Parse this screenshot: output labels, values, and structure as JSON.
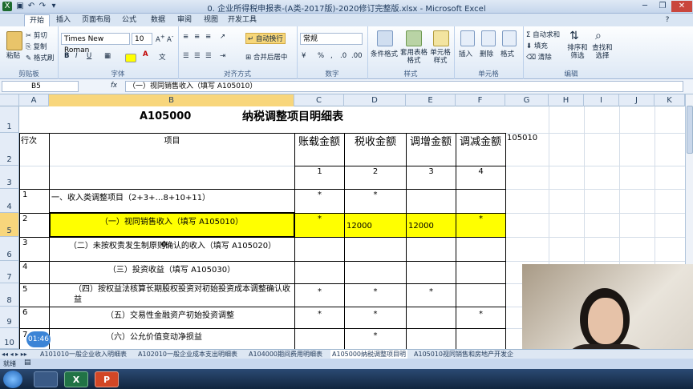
{
  "window": {
    "title": "0. 企业所得税申报表-(A类-2017版)-2020修订完整版.xlsx - Microsoft Excel"
  },
  "ribbon_tabs": [
    "开始",
    "插入",
    "页面布局",
    "公式",
    "数据",
    "审阅",
    "视图",
    "开发工具"
  ],
  "ribbon": {
    "clipboard": {
      "paste": "粘贴",
      "cut": "剪切",
      "copy": "复制",
      "format_painter": "格式刷",
      "label": "剪贴板"
    },
    "font": {
      "name": "Times New Roman",
      "size": "10",
      "bold": "B",
      "italic": "I",
      "underline": "U",
      "label": "字体"
    },
    "alignment": {
      "wrap": "自动换行",
      "merge": "合并后居中",
      "label": "对齐方式"
    },
    "number": {
      "format": "常规",
      "percent": "%",
      "comma": ",",
      "label": "数字"
    },
    "styles": {
      "conditional": "条件格式",
      "table": "套用表格格式",
      "cell_styles": "单元格样式",
      "label": "样式"
    },
    "cells": {
      "insert": "插入",
      "delete": "删除",
      "format": "格式",
      "label": "单元格"
    },
    "editing": {
      "autosum": "自动求和",
      "fill": "填充",
      "clear": "清除",
      "sort": "排序和筛选",
      "find": "查找和选择",
      "label": "编辑"
    }
  },
  "formula_bar": {
    "name_box": "B5",
    "fx": "fx",
    "content": "（一）视同销售收入（填写 A105010）"
  },
  "columns": [
    "A",
    "B",
    "C",
    "D",
    "E",
    "F",
    "G",
    "H",
    "I",
    "J",
    "K"
  ],
  "rows": [
    "1",
    "2",
    "3",
    "4",
    "5",
    "6",
    "7",
    "8",
    "9",
    "10"
  ],
  "sheet": {
    "code": "A105000",
    "title": "纳税调整项目明细表",
    "header_row_no": "行次",
    "header_item": "项目",
    "header_c": "账载金额",
    "header_d": "税收金额",
    "header_e": "调增金额",
    "header_f": "调减金额",
    "g2": "105010",
    "col_nums": [
      "1",
      "2",
      "3",
      "4"
    ],
    "rows": [
      {
        "no": "1",
        "item": "一、收入类调整项目（2+3+…8+10+11）",
        "c": "*",
        "d": "*",
        "e": "",
        "f": ""
      },
      {
        "no": "2",
        "item": "（一）视同销售收入（填写 A105010）",
        "c": "*",
        "d": "12000",
        "e": "12000",
        "f": "*"
      },
      {
        "no": "3",
        "item": "（二）未按权责发生制原则确认的收入（填写 A105020）",
        "c": "",
        "d": "",
        "e": "",
        "f": ""
      },
      {
        "no": "4",
        "item": "（三）投资收益（填写 A105030）",
        "c": "",
        "d": "",
        "e": "",
        "f": ""
      },
      {
        "no": "5",
        "item": "（四）按权益法核算长期股权投资对初始投资成本调整确认收益",
        "c": "*",
        "d": "*",
        "e": "*",
        "f": ""
      },
      {
        "no": "6",
        "item": "（五）交易性金融资产初始投资调整",
        "c": "*",
        "d": "*",
        "e": "",
        "f": "*"
      },
      {
        "no": "7",
        "item": "（六）公允价值变动净损益",
        "c": "",
        "d": "*",
        "e": "",
        "f": ""
      }
    ]
  },
  "sheet_tabs": [
    "A101010一般企业收入明细表",
    "A102010一般企业成本支出明细表",
    "A104000期间费用明细表",
    "A105000纳税调整项目明",
    "A105010视同销售和房地产开发企"
  ],
  "status": {
    "ready": "就绪"
  },
  "video": {
    "timer": "01:46"
  },
  "colors": {
    "highlight": "#ffff00",
    "selected_header": "#f8d67c",
    "ribbon_bg": "#dde8f5"
  }
}
